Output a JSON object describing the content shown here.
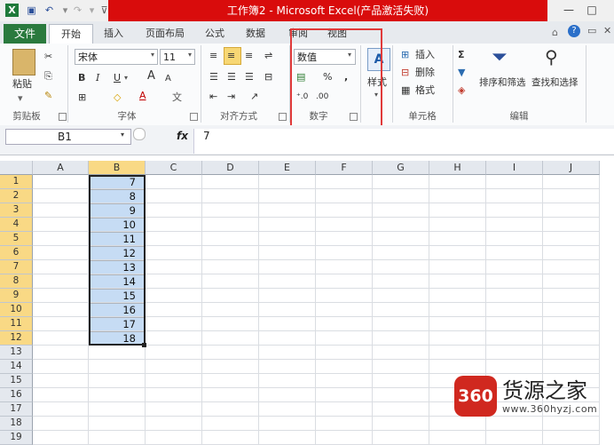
{
  "window": {
    "title": "工作簿2 - Microsoft Excel(产品激活失败)",
    "minimize": "—",
    "maximize": "□",
    "accent": "#d90c0c"
  },
  "tabs": {
    "file": "文件",
    "items": [
      "开始",
      "插入",
      "页面布局",
      "公式",
      "数据",
      "审阅",
      "视图"
    ]
  },
  "ribbon": {
    "clipboard": {
      "paste": "粘贴",
      "label": "剪贴板"
    },
    "font": {
      "name": "宋体",
      "size": "11",
      "bold": "B",
      "italic": "I",
      "underline": "U",
      "grow": "A",
      "shrink": "A",
      "color_a": "A",
      "label": "字体"
    },
    "alignment": {
      "label": "对齐方式"
    },
    "number": {
      "format": "数值",
      "percent": "%",
      "comma": ",",
      "label": "数字"
    },
    "styles": {
      "label": "样式"
    },
    "cells": {
      "insert": "插入",
      "delete": "删除",
      "format": "格式",
      "label": "单元格"
    },
    "editing": {
      "sigma": "Σ",
      "sort": "排序和筛选",
      "find": "查找和选择",
      "label": "编辑"
    }
  },
  "formula_bar": {
    "name_box": "B1",
    "fx": "fx",
    "value": "7"
  },
  "sheet": {
    "columns": [
      "A",
      "B",
      "C",
      "D",
      "E",
      "F",
      "G",
      "H",
      "I",
      "J"
    ],
    "rows": [
      "1",
      "2",
      "3",
      "4",
      "5",
      "6",
      "7",
      "8",
      "9",
      "10",
      "11",
      "12",
      "13",
      "14",
      "15",
      "16",
      "17",
      "18",
      "19"
    ],
    "column_b_values": [
      "7",
      "8",
      "9",
      "10",
      "11",
      "12",
      "13",
      "14",
      "15",
      "16",
      "17",
      "18"
    ],
    "selection_color": "#c6dcf4"
  },
  "watermark": {
    "logo": "360",
    "name": "货源之家",
    "url": "www.360hyzj.com"
  }
}
